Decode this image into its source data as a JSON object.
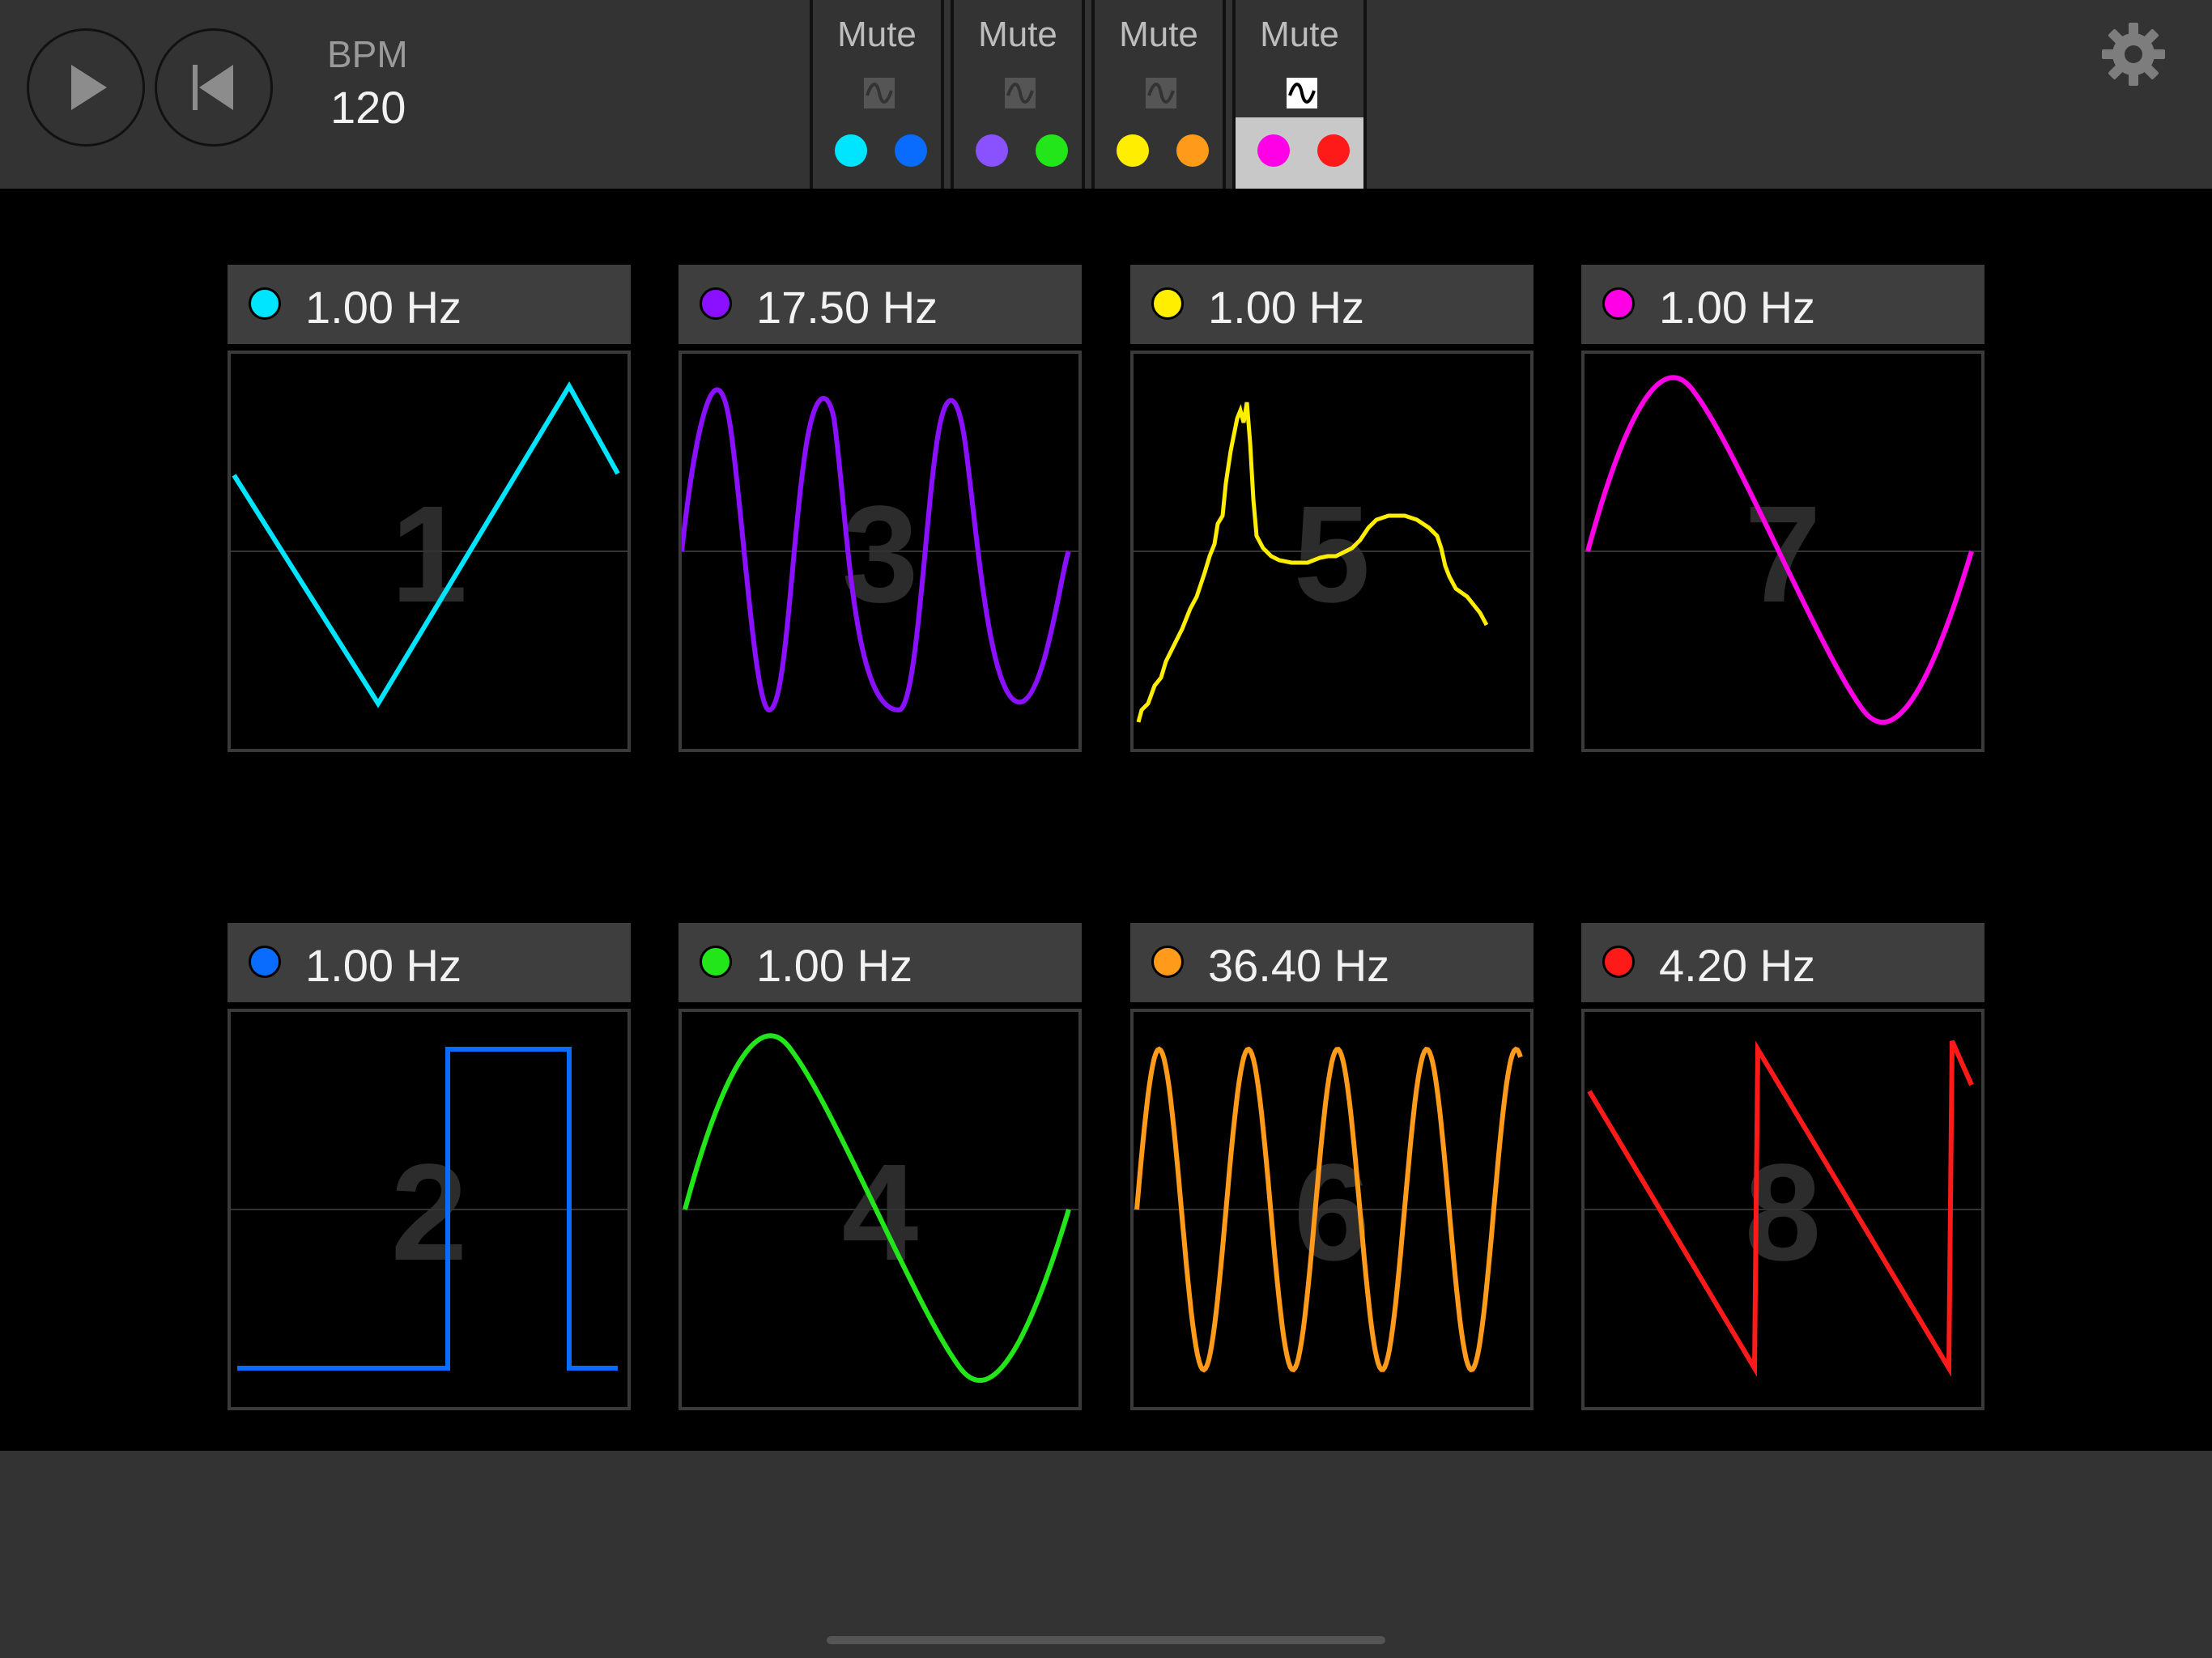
{
  "transport": {
    "play_icon": "play-icon",
    "rewind_icon": "skip-to-start-icon",
    "bpm_label": "BPM",
    "bpm_value": "120"
  },
  "settings_icon": "gear-icon",
  "channels": [
    {
      "mute_label": "Mute",
      "wave_icon": "lfo-wave-icon",
      "selected": false,
      "colors": [
        "#00e5ff",
        "#0a6cff"
      ]
    },
    {
      "mute_label": "Mute",
      "wave_icon": "lfo-wave-icon",
      "selected": false,
      "colors": [
        "#8a52ff",
        "#22e51a"
      ]
    },
    {
      "mute_label": "Mute",
      "wave_icon": "lfo-wave-icon",
      "selected": false,
      "colors": [
        "#ffee00",
        "#ff9a1a"
      ]
    },
    {
      "mute_label": "Mute",
      "wave_icon": "lfo-wave-icon",
      "selected": true,
      "colors": [
        "#ff00e6",
        "#ff1a1a"
      ]
    }
  ],
  "panels": [
    {
      "number": "1",
      "freq": "1.00 Hz",
      "color": "#00e5ff",
      "waveform": "triangle"
    },
    {
      "number": "3",
      "freq": "17.50 Hz",
      "color": "#8a10ff",
      "waveform": "sine"
    },
    {
      "number": "5",
      "freq": "1.00 Hz",
      "color": "#ffee00",
      "waveform": "random"
    },
    {
      "number": "7",
      "freq": "1.00 Hz",
      "color": "#ff00e6",
      "waveform": "sine"
    },
    {
      "number": "2",
      "freq": "1.00 Hz",
      "color": "#0a6cff",
      "waveform": "square"
    },
    {
      "number": "4",
      "freq": "1.00 Hz",
      "color": "#22e51a",
      "waveform": "sine"
    },
    {
      "number": "6",
      "freq": "36.40 Hz",
      "color": "#ff9a1a",
      "waveform": "sine"
    },
    {
      "number": "8",
      "freq": "4.20 Hz",
      "color": "#ff1a1a",
      "waveform": "sawtooth"
    }
  ]
}
